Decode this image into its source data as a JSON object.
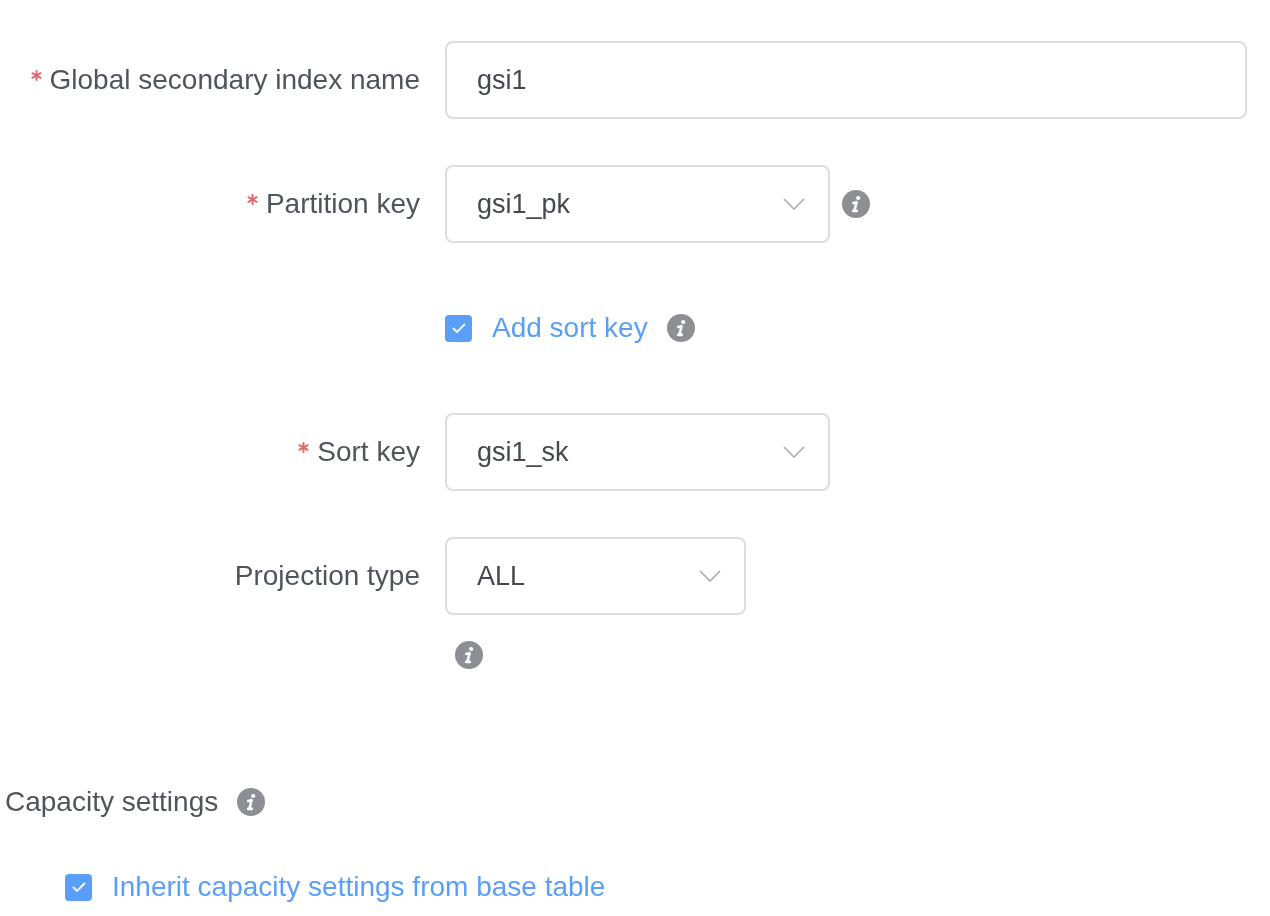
{
  "fields": [
    {
      "kind": "text",
      "label": "Global secondary index name",
      "required": true,
      "value": "gsi1",
      "info": false
    },
    {
      "kind": "select",
      "label": "Partition key",
      "required": true,
      "value": "gsi1_pk",
      "info": true
    },
    {
      "kind": "checkbox",
      "label": "Add sort key",
      "checked": true,
      "info": true
    },
    {
      "kind": "select",
      "label": "Sort key",
      "required": true,
      "value": "gsi1_sk",
      "info": false
    },
    {
      "kind": "select",
      "label": "Projection type",
      "required": false,
      "value": "ALL",
      "info": true,
      "info_below": true
    }
  ],
  "capacity": {
    "title": "Capacity settings",
    "info": true,
    "options": [
      {
        "label": "Inherit capacity settings from base table",
        "checked": true
      }
    ]
  }
}
